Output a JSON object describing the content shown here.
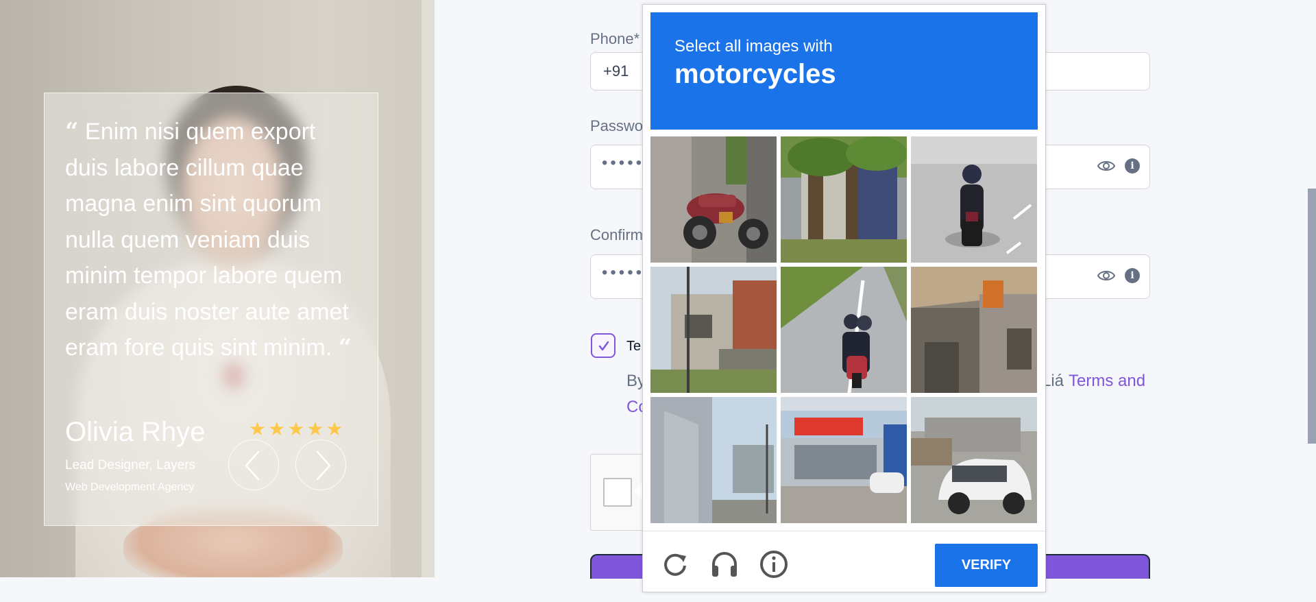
{
  "testimonial": {
    "quote_open": "“",
    "quote": "Enim nisi quem export duis labore cillum quae magna enim sint quorum nulla quem veniam duis minim tempor labore quem eram duis noster aute amet eram fore quis sint minim.",
    "quote_close": "“",
    "author": "Olivia Rhye",
    "role": "Lead Designer, Layers",
    "company": "Web Development Agency",
    "rating": 5,
    "star_glyph": "★",
    "icons": {
      "prev": "chevron-left-icon",
      "next": "chevron-right-icon"
    }
  },
  "form": {
    "phone_label": "Phone*",
    "phone_code": "+91",
    "password_label": "Passwo",
    "password_mask": "•••••",
    "confirm_label": "Confirm",
    "confirm_mask": "•••••",
    "terms_label": "Te",
    "terms_checked": true,
    "terms_by": "By",
    "terms_co": "Co",
    "terms_mid": "Liá",
    "terms_link": "Terms and",
    "icons": {
      "show_password": "eye-icon",
      "info": "info-icon",
      "check": "check-icon"
    }
  },
  "captcha": {
    "instruction": "Select all images with",
    "target": "motorcycles",
    "verify_label": "VERIFY",
    "tiles": [
      "motorcycle-parked",
      "tree-wall",
      "motorcycle-rider-road",
      "houses-street",
      "motorcycle-two-riders",
      "house-orange",
      "building-street",
      "storefront",
      "white-car"
    ],
    "icons": {
      "reload": "reload-icon",
      "audio": "headphones-icon",
      "info": "info-circle-icon"
    }
  },
  "colors": {
    "captcha_blue": "#1a73e8",
    "brand_purple": "#7f56d9",
    "star_yellow": "#fec84b"
  }
}
